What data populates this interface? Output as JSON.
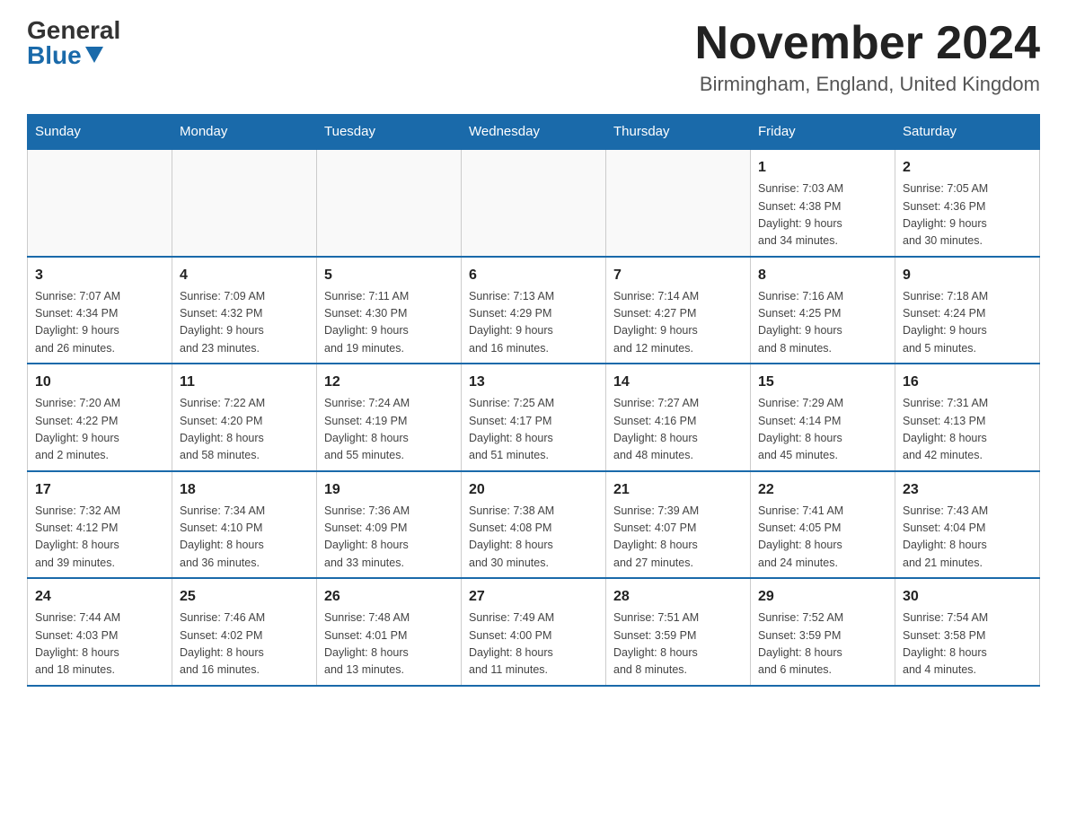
{
  "logo": {
    "general": "General",
    "blue": "Blue"
  },
  "header": {
    "month": "November 2024",
    "location": "Birmingham, England, United Kingdom"
  },
  "weekdays": [
    "Sunday",
    "Monday",
    "Tuesday",
    "Wednesday",
    "Thursday",
    "Friday",
    "Saturday"
  ],
  "weeks": [
    [
      {
        "day": "",
        "info": ""
      },
      {
        "day": "",
        "info": ""
      },
      {
        "day": "",
        "info": ""
      },
      {
        "day": "",
        "info": ""
      },
      {
        "day": "",
        "info": ""
      },
      {
        "day": "1",
        "info": "Sunrise: 7:03 AM\nSunset: 4:38 PM\nDaylight: 9 hours\nand 34 minutes."
      },
      {
        "day": "2",
        "info": "Sunrise: 7:05 AM\nSunset: 4:36 PM\nDaylight: 9 hours\nand 30 minutes."
      }
    ],
    [
      {
        "day": "3",
        "info": "Sunrise: 7:07 AM\nSunset: 4:34 PM\nDaylight: 9 hours\nand 26 minutes."
      },
      {
        "day": "4",
        "info": "Sunrise: 7:09 AM\nSunset: 4:32 PM\nDaylight: 9 hours\nand 23 minutes."
      },
      {
        "day": "5",
        "info": "Sunrise: 7:11 AM\nSunset: 4:30 PM\nDaylight: 9 hours\nand 19 minutes."
      },
      {
        "day": "6",
        "info": "Sunrise: 7:13 AM\nSunset: 4:29 PM\nDaylight: 9 hours\nand 16 minutes."
      },
      {
        "day": "7",
        "info": "Sunrise: 7:14 AM\nSunset: 4:27 PM\nDaylight: 9 hours\nand 12 minutes."
      },
      {
        "day": "8",
        "info": "Sunrise: 7:16 AM\nSunset: 4:25 PM\nDaylight: 9 hours\nand 8 minutes."
      },
      {
        "day": "9",
        "info": "Sunrise: 7:18 AM\nSunset: 4:24 PM\nDaylight: 9 hours\nand 5 minutes."
      }
    ],
    [
      {
        "day": "10",
        "info": "Sunrise: 7:20 AM\nSunset: 4:22 PM\nDaylight: 9 hours\nand 2 minutes."
      },
      {
        "day": "11",
        "info": "Sunrise: 7:22 AM\nSunset: 4:20 PM\nDaylight: 8 hours\nand 58 minutes."
      },
      {
        "day": "12",
        "info": "Sunrise: 7:24 AM\nSunset: 4:19 PM\nDaylight: 8 hours\nand 55 minutes."
      },
      {
        "day": "13",
        "info": "Sunrise: 7:25 AM\nSunset: 4:17 PM\nDaylight: 8 hours\nand 51 minutes."
      },
      {
        "day": "14",
        "info": "Sunrise: 7:27 AM\nSunset: 4:16 PM\nDaylight: 8 hours\nand 48 minutes."
      },
      {
        "day": "15",
        "info": "Sunrise: 7:29 AM\nSunset: 4:14 PM\nDaylight: 8 hours\nand 45 minutes."
      },
      {
        "day": "16",
        "info": "Sunrise: 7:31 AM\nSunset: 4:13 PM\nDaylight: 8 hours\nand 42 minutes."
      }
    ],
    [
      {
        "day": "17",
        "info": "Sunrise: 7:32 AM\nSunset: 4:12 PM\nDaylight: 8 hours\nand 39 minutes."
      },
      {
        "day": "18",
        "info": "Sunrise: 7:34 AM\nSunset: 4:10 PM\nDaylight: 8 hours\nand 36 minutes."
      },
      {
        "day": "19",
        "info": "Sunrise: 7:36 AM\nSunset: 4:09 PM\nDaylight: 8 hours\nand 33 minutes."
      },
      {
        "day": "20",
        "info": "Sunrise: 7:38 AM\nSunset: 4:08 PM\nDaylight: 8 hours\nand 30 minutes."
      },
      {
        "day": "21",
        "info": "Sunrise: 7:39 AM\nSunset: 4:07 PM\nDaylight: 8 hours\nand 27 minutes."
      },
      {
        "day": "22",
        "info": "Sunrise: 7:41 AM\nSunset: 4:05 PM\nDaylight: 8 hours\nand 24 minutes."
      },
      {
        "day": "23",
        "info": "Sunrise: 7:43 AM\nSunset: 4:04 PM\nDaylight: 8 hours\nand 21 minutes."
      }
    ],
    [
      {
        "day": "24",
        "info": "Sunrise: 7:44 AM\nSunset: 4:03 PM\nDaylight: 8 hours\nand 18 minutes."
      },
      {
        "day": "25",
        "info": "Sunrise: 7:46 AM\nSunset: 4:02 PM\nDaylight: 8 hours\nand 16 minutes."
      },
      {
        "day": "26",
        "info": "Sunrise: 7:48 AM\nSunset: 4:01 PM\nDaylight: 8 hours\nand 13 minutes."
      },
      {
        "day": "27",
        "info": "Sunrise: 7:49 AM\nSunset: 4:00 PM\nDaylight: 8 hours\nand 11 minutes."
      },
      {
        "day": "28",
        "info": "Sunrise: 7:51 AM\nSunset: 3:59 PM\nDaylight: 8 hours\nand 8 minutes."
      },
      {
        "day": "29",
        "info": "Sunrise: 7:52 AM\nSunset: 3:59 PM\nDaylight: 8 hours\nand 6 minutes."
      },
      {
        "day": "30",
        "info": "Sunrise: 7:54 AM\nSunset: 3:58 PM\nDaylight: 8 hours\nand 4 minutes."
      }
    ]
  ]
}
